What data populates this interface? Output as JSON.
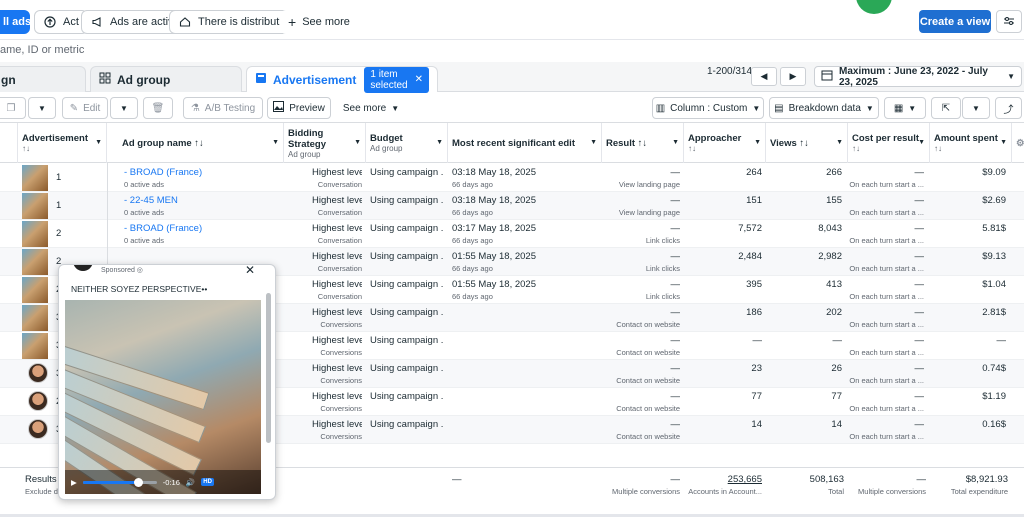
{
  "filters": {
    "chips": [
      {
        "label": "ll ads",
        "icon": "none"
      },
      {
        "label": "Act",
        "icon": "arrow-up-circle-icon"
      },
      {
        "label": "Ads are active",
        "icon": "megaphone-icon"
      },
      {
        "label": "There is distribution",
        "icon": "inbox-icon"
      }
    ],
    "see_more": "See more",
    "create_view": "Create a view"
  },
  "search": {
    "placeholder": "ame, ID or metric"
  },
  "tabs": {
    "campaign": "gn",
    "ad_group": "Ad group",
    "advertisement": "Advertisement",
    "selected_badge": "1 item selected"
  },
  "pagination": {
    "range": "1-200/314"
  },
  "date_range": "Maximum : June 23, 2022 - July 23, 2025",
  "toolbar": {
    "edit": "Edit",
    "ab_testing": "A/B Testing",
    "preview": "Preview",
    "see_more": "See more",
    "column": "Column : Custom",
    "breakdown": "Breakdown data"
  },
  "columns": {
    "advertisement": "Advertisement",
    "ad_group_name": "Ad group name",
    "bidding": "Bidding Strategy",
    "bidding_sub": "Ad group",
    "budget": "Budget",
    "budget_sub": "Ad group",
    "recent_edit": "Most recent significant edit",
    "result": "Result",
    "approacher": "Approacher",
    "views": "Views",
    "cost_per_result": "Cost per result",
    "amount_spent": "Amount spent"
  },
  "rows": [
    {
      "num": "1",
      "name": "- BROAD (France)",
      "sub": "0 active ads",
      "bid": "Highest level",
      "bid_sub": "Conversation",
      "budget": "Using campaign ...",
      "edit": "03:18 May 18, 2025",
      "edit_sub": "66 days ago",
      "result": "—",
      "result_sub": "View landing page",
      "reach": "264",
      "views": "266",
      "cpr": "—",
      "cpr_sub": "On each turn start a ...",
      "spent": "$9.09"
    },
    {
      "num": "1",
      "name": "- 22-45 MEN",
      "sub": "0 active ads",
      "bid": "Highest level",
      "bid_sub": "Conversation",
      "budget": "Using campaign ...",
      "edit": "03:18 May 18, 2025",
      "edit_sub": "66 days ago",
      "result": "—",
      "result_sub": "View landing page",
      "reach": "151",
      "views": "155",
      "cpr": "—",
      "cpr_sub": "On each turn start a ...",
      "spent": "$2.69"
    },
    {
      "num": "2",
      "name": "- BROAD (France)",
      "sub": "0 active ads",
      "bid": "Highest level",
      "bid_sub": "Conversation",
      "budget": "Using campaign ...",
      "edit": "03:17 May 18, 2025",
      "edit_sub": "66 days ago",
      "result": "—",
      "result_sub": "Link clicks",
      "reach": "7,572",
      "views": "8,043",
      "cpr": "—",
      "cpr_sub": "On each turn start a ...",
      "spent": "5.81$"
    },
    {
      "num": "2",
      "name": "",
      "sub": "",
      "bid": "Highest level",
      "bid_sub": "Conversation",
      "budget": "Using campaign ...",
      "edit": "01:55 May 18, 2025",
      "edit_sub": "66 days ago",
      "result": "—",
      "result_sub": "Link clicks",
      "reach": "2,484",
      "views": "2,982",
      "cpr": "—",
      "cpr_sub": "On each turn start a ...",
      "spent": "$9.13"
    },
    {
      "num": "2",
      "name": "",
      "sub": "",
      "bid": "Highest level",
      "bid_sub": "Conversation",
      "budget": "Using campaign ...",
      "edit": "01:55 May 18, 2025",
      "edit_sub": "66 days ago",
      "result": "—",
      "result_sub": "Link clicks",
      "reach": "395",
      "views": "413",
      "cpr": "—",
      "cpr_sub": "On each turn start a ...",
      "spent": "$1.04"
    },
    {
      "num": "3",
      "name": "",
      "sub": "",
      "bid": "Highest level",
      "bid_sub": "Conversions",
      "budget": "Using campaign ...",
      "edit": "",
      "edit_sub": "",
      "result": "—",
      "result_sub": "Contact on website",
      "reach": "186",
      "views": "202",
      "cpr": "—",
      "cpr_sub": "On each turn start a ...",
      "spent": "2.81$"
    },
    {
      "num": "3",
      "name": "",
      "sub": "",
      "bid": "Highest level",
      "bid_sub": "Conversions",
      "budget": "Using campaign ...",
      "edit": "",
      "edit_sub": "",
      "result": "—",
      "result_sub": "Contact on website",
      "reach": "—",
      "views": "—",
      "cpr": "—",
      "cpr_sub": "On each turn start a ...",
      "spent": "—"
    },
    {
      "num": "3",
      "name": "",
      "sub": "",
      "bid": "Highest level",
      "bid_sub": "Conversions",
      "budget": "Using campaign ...",
      "edit": "",
      "edit_sub": "",
      "result": "—",
      "result_sub": "Contact on website",
      "reach": "23",
      "views": "26",
      "cpr": "—",
      "cpr_sub": "On each turn start a ...",
      "spent": "0.74$"
    },
    {
      "num": "2",
      "name": "",
      "sub": "",
      "bid": "Highest level",
      "bid_sub": "Conversions",
      "budget": "Using campaign ...",
      "edit": "",
      "edit_sub": "",
      "result": "—",
      "result_sub": "Contact on website",
      "reach": "77",
      "views": "77",
      "cpr": "—",
      "cpr_sub": "On each turn start a ...",
      "spent": "$1.19"
    },
    {
      "num": "3",
      "name": "",
      "sub": "",
      "bid": "Highest level",
      "bid_sub": "Conversions",
      "budget": "Using campaign ...",
      "edit": "",
      "edit_sub": "",
      "result": "—",
      "result_sub": "Contact on website",
      "reach": "14",
      "views": "14",
      "cpr": "—",
      "cpr_sub": "On each turn start a ...",
      "spent": "0.16$"
    }
  ],
  "totals": {
    "label": "Results fr",
    "label_sub": "Exclude de",
    "edit": "—",
    "result": "—",
    "result_sub": "Multiple conversions",
    "reach": "253,665",
    "reach_sub": "Accounts in Account...",
    "views": "508,163",
    "views_sub": "Total",
    "cpr": "—",
    "cpr_sub": "Multiple conversions",
    "spent": "$8,921.93",
    "spent_sub": "Total expenditure"
  },
  "preview": {
    "sponsored": "Sponsored",
    "caption": "NEITHER SOYEZ PERSPECTIVE",
    "time": "-0:16",
    "hd": "HD",
    "progress": 0.75
  },
  "colors": {
    "accent": "#1877f2",
    "primary_button": "#1f6fd1",
    "green_avatar": "#2aa857"
  }
}
